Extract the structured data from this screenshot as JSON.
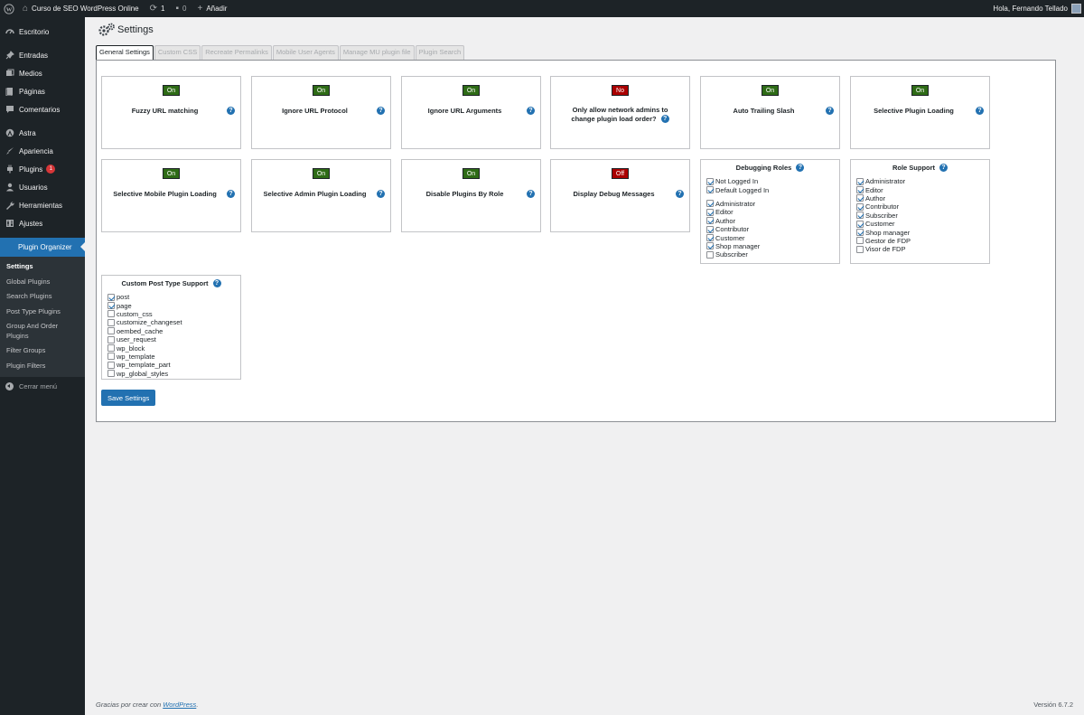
{
  "adminbar": {
    "site_name": "Curso de SEO WordPress Online",
    "updates_count": "1",
    "comments_count": "0",
    "new_label": "Añadir",
    "greeting": "Hola, Fernando Tellado"
  },
  "sidebar": {
    "items": [
      {
        "label": "Escritorio",
        "icon": "dashboard-icon"
      },
      {
        "label": "Entradas",
        "icon": "pin-icon"
      },
      {
        "label": "Medios",
        "icon": "media-icon"
      },
      {
        "label": "Páginas",
        "icon": "page-icon"
      },
      {
        "label": "Comentarios",
        "icon": "comment-icon"
      },
      {
        "label": "Astra",
        "icon": "astra-icon"
      },
      {
        "label": "Apariencia",
        "icon": "brush-icon"
      },
      {
        "label": "Plugins",
        "icon": "plugin-icon",
        "badge": "1"
      },
      {
        "label": "Usuarios",
        "icon": "user-icon"
      },
      {
        "label": "Herramientas",
        "icon": "wrench-icon"
      },
      {
        "label": "Ajustes",
        "icon": "settings-icon"
      }
    ],
    "current": "Plugin Organizer",
    "submenu": [
      "Settings",
      "Global Plugins",
      "Search Plugins",
      "Post Type Plugins",
      "Group And Order Plugins",
      "Filter Groups",
      "Plugin Filters"
    ],
    "collapse_label": "Cerrar menú"
  },
  "page": {
    "title": "Settings"
  },
  "tabs": [
    "General Settings",
    "Custom CSS",
    "Recreate Permalinks",
    "Mobile User Agents",
    "Manage MU plugin file",
    "Plugin Search"
  ],
  "cards": [
    {
      "state": "On",
      "label": "Fuzzy URL matching"
    },
    {
      "state": "On",
      "label": "Ignore URL Protocol"
    },
    {
      "state": "On",
      "label": "Ignore URL Arguments"
    },
    {
      "state": "No",
      "label": "Only allow network admins to change plugin load order?"
    },
    {
      "state": "On",
      "label": "Auto Trailing Slash"
    },
    {
      "state": "On",
      "label": "Selective Plugin Loading"
    },
    {
      "state": "On",
      "label": "Selective Mobile Plugin Loading"
    },
    {
      "state": "On",
      "label": "Selective Admin Plugin Loading"
    },
    {
      "state": "On",
      "label": "Disable Plugins By Role"
    },
    {
      "state": "Off",
      "label": "Display Debug Messages"
    }
  ],
  "debugging_roles": {
    "title": "Debugging Roles",
    "group1": [
      {
        "label": "Not Logged In",
        "checked": true
      },
      {
        "label": "Default Logged In",
        "checked": true
      }
    ],
    "group2": [
      {
        "label": "Administrator",
        "checked": true
      },
      {
        "label": "Editor",
        "checked": true
      },
      {
        "label": "Author",
        "checked": true
      },
      {
        "label": "Contributor",
        "checked": true
      },
      {
        "label": "Customer",
        "checked": true
      },
      {
        "label": "Shop manager",
        "checked": true
      },
      {
        "label": "Subscriber",
        "checked": false
      }
    ]
  },
  "role_support": {
    "title": "Role Support",
    "items": [
      {
        "label": "Administrator",
        "checked": true
      },
      {
        "label": "Editor",
        "checked": true
      },
      {
        "label": "Author",
        "checked": true
      },
      {
        "label": "Contributor",
        "checked": true
      },
      {
        "label": "Subscriber",
        "checked": true
      },
      {
        "label": "Customer",
        "checked": true
      },
      {
        "label": "Shop manager",
        "checked": true
      },
      {
        "label": "Gestor de FDP",
        "checked": false
      },
      {
        "label": "Visor de FDP",
        "checked": false
      }
    ]
  },
  "post_type_support": {
    "title": "Custom Post Type Support",
    "items": [
      {
        "label": "post",
        "checked": true
      },
      {
        "label": "page",
        "checked": true
      },
      {
        "label": "custom_css",
        "checked": false
      },
      {
        "label": "customize_changeset",
        "checked": false
      },
      {
        "label": "oembed_cache",
        "checked": false
      },
      {
        "label": "user_request",
        "checked": false
      },
      {
        "label": "wp_block",
        "checked": false
      },
      {
        "label": "wp_template",
        "checked": false
      },
      {
        "label": "wp_template_part",
        "checked": false
      },
      {
        "label": "wp_global_styles",
        "checked": false
      }
    ]
  },
  "save_label": "Save Settings",
  "footer": {
    "text": "Gracias por crear con",
    "link": "WordPress",
    "version": "Versión 6.7.2"
  },
  "colors": {
    "accent": "#2271b1",
    "on": "#2e6b16",
    "off": "#aa0000",
    "sidebar": "#1d2327"
  }
}
